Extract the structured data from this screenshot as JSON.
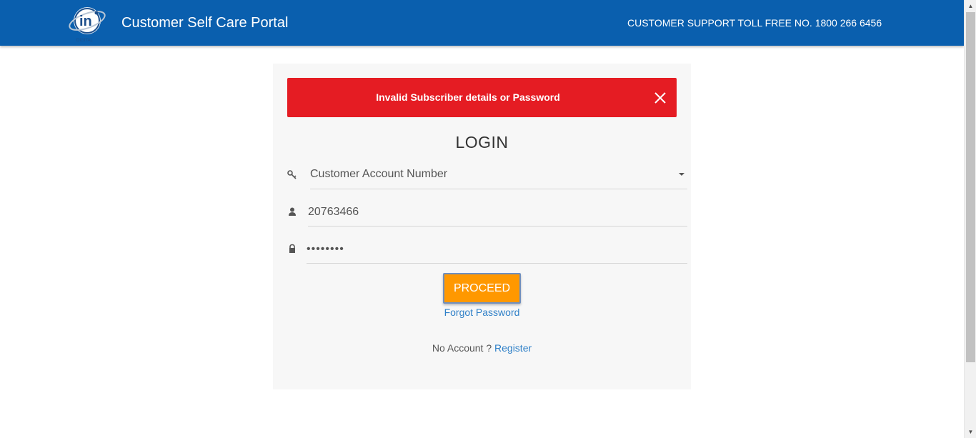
{
  "header": {
    "title": "Customer Self Care Portal",
    "support": "CUSTOMER SUPPORT TOLL FREE NO. 1800 266 6456",
    "logo_icon": "in-digital-globe-logo",
    "background_color": "#0a5fae"
  },
  "alert": {
    "message": "Invalid Subscriber details or Password",
    "background_color": "#e51c23",
    "close_icon": "close-icon"
  },
  "login": {
    "title": "LOGIN",
    "account_type": {
      "icon": "key-icon",
      "selected": "Customer Account Number"
    },
    "username": {
      "icon": "user-icon",
      "value": "20763466"
    },
    "password": {
      "icon": "lock-icon",
      "value": "••••••••"
    },
    "proceed_label": "PROCEED",
    "proceed_color": "#ff9800",
    "forgot_label": "Forgot Password",
    "no_account_text": "No Account ?",
    "register_label": "Register",
    "link_color": "#2f80c8"
  }
}
